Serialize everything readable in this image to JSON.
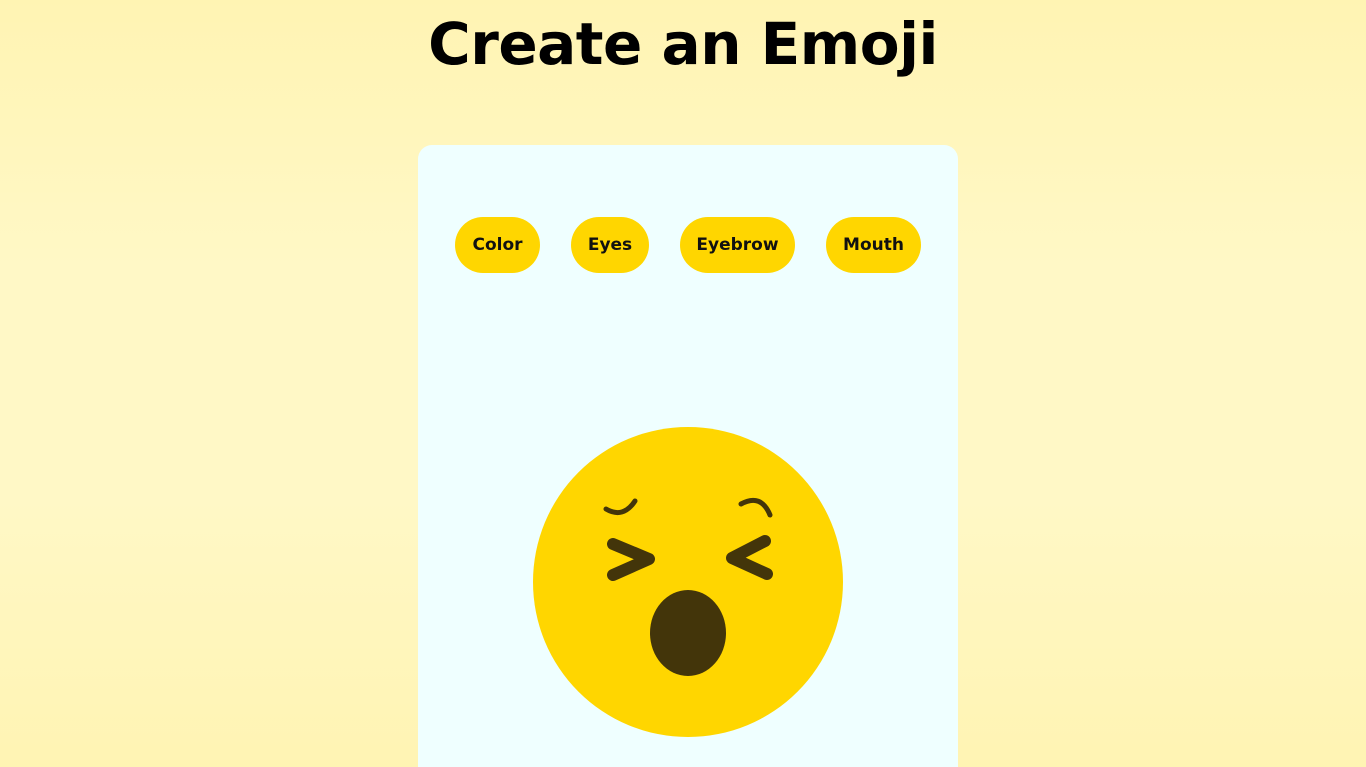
{
  "page": {
    "title": "Create an Emoji"
  },
  "tabs": [
    {
      "label": "Color"
    },
    {
      "label": "Eyes"
    },
    {
      "label": "Eyebrow"
    },
    {
      "label": "Mouth"
    }
  ],
  "emoji": {
    "face_color": "#ffd600",
    "feature_color": "#43350a",
    "eyes": "squint-eyes-icon",
    "eyebrows": "curved-eyebrows-icon",
    "mouth": "open-oval-mouth-icon"
  },
  "colors": {
    "background": "#fff8c6",
    "card": "#efffff",
    "button": "#ffd600",
    "text": "#000000"
  }
}
